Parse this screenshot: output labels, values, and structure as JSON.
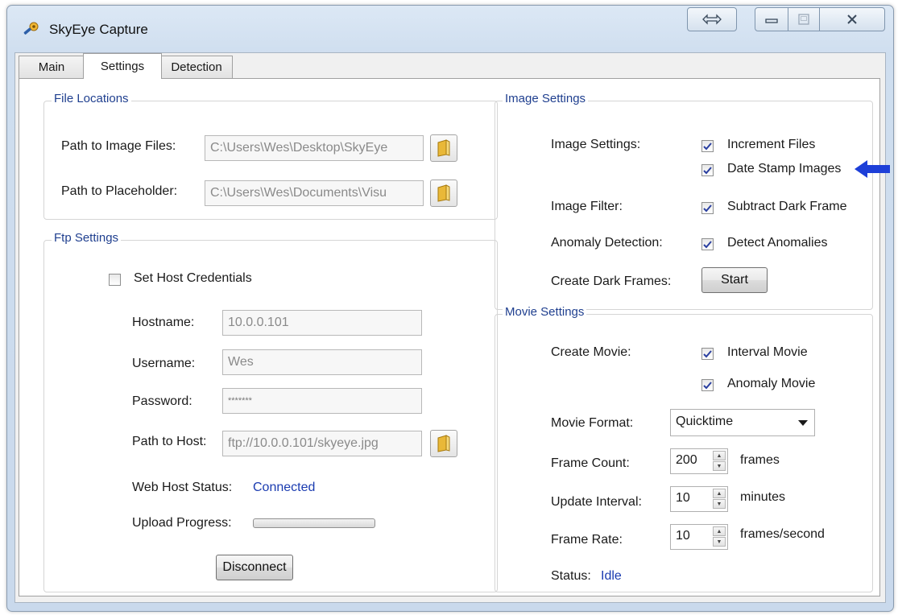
{
  "window": {
    "title": "SkyEye Capture"
  },
  "tabs": [
    {
      "label": "Main",
      "active": false
    },
    {
      "label": "Settings",
      "active": true
    },
    {
      "label": "Detection",
      "active": false
    }
  ],
  "file_locations": {
    "title": "File Locations",
    "image_files": {
      "label": "Path to Image Files:",
      "value": "C:\\Users\\Wes\\Desktop\\SkyEye"
    },
    "placeholder": {
      "label": "Path to Placeholder:",
      "value": "C:\\Users\\Wes\\Documents\\Visu"
    }
  },
  "ftp_settings": {
    "title": "Ftp Settings",
    "set_host_credentials": {
      "label": "Set Host Credentials",
      "checked": false
    },
    "hostname": {
      "label": "Hostname:",
      "value": "10.0.0.101"
    },
    "username": {
      "label": "Username:",
      "value": "Wes"
    },
    "password": {
      "label": "Password:",
      "value": "*******"
    },
    "path_to_host": {
      "label": "Path to Host:",
      "value": "ftp://10.0.0.101/skyeye.jpg"
    },
    "web_host_status": {
      "label": "Web Host Status:",
      "value": "Connected"
    },
    "upload_progress": {
      "label": "Upload Progress:",
      "fraction": 0
    },
    "disconnect_label": "Disconnect"
  },
  "image_settings": {
    "title": "Image Settings",
    "image_settings_label": "Image Settings:",
    "increment_files": {
      "label": "Increment Files",
      "checked": true
    },
    "date_stamp_images": {
      "label": "Date Stamp Images",
      "checked": true
    },
    "image_filter_label": "Image Filter:",
    "subtract_dark_frame": {
      "label": "Subtract Dark Frame",
      "checked": true
    },
    "anomaly_detection_label": "Anomaly Detection:",
    "detect_anomalies": {
      "label": "Detect Anomalies",
      "checked": true
    },
    "create_dark_frames_label": "Create Dark Frames:",
    "start_label": "Start"
  },
  "movie_settings": {
    "title": "Movie Settings",
    "create_movie_label": "Create Movie:",
    "interval_movie": {
      "label": "Interval Movie",
      "checked": true
    },
    "anomaly_movie": {
      "label": "Anomaly Movie",
      "checked": true
    },
    "movie_format": {
      "label": "Movie Format:",
      "value": "Quicktime"
    },
    "frame_count": {
      "label": "Frame Count:",
      "value": "200",
      "unit": "frames"
    },
    "update_interval": {
      "label": "Update Interval:",
      "value": "10",
      "unit": "minutes"
    },
    "frame_rate": {
      "label": "Frame Rate:",
      "value": "10",
      "unit": "frames/second"
    },
    "status": {
      "label": "Status:",
      "value": "Idle"
    }
  },
  "colors": {
    "accent_text": "#1a3bb0",
    "arrow": "#1d3fd8",
    "group_title": "#1f3f8f"
  },
  "icons": [
    "app-key-icon",
    "resize-icon",
    "minimize-icon",
    "maximize-icon",
    "close-icon",
    "folder-icon",
    "checkmark-icon",
    "dropdown-arrow-icon",
    "spin-up-icon",
    "spin-down-icon",
    "blue-arrow-icon"
  ]
}
